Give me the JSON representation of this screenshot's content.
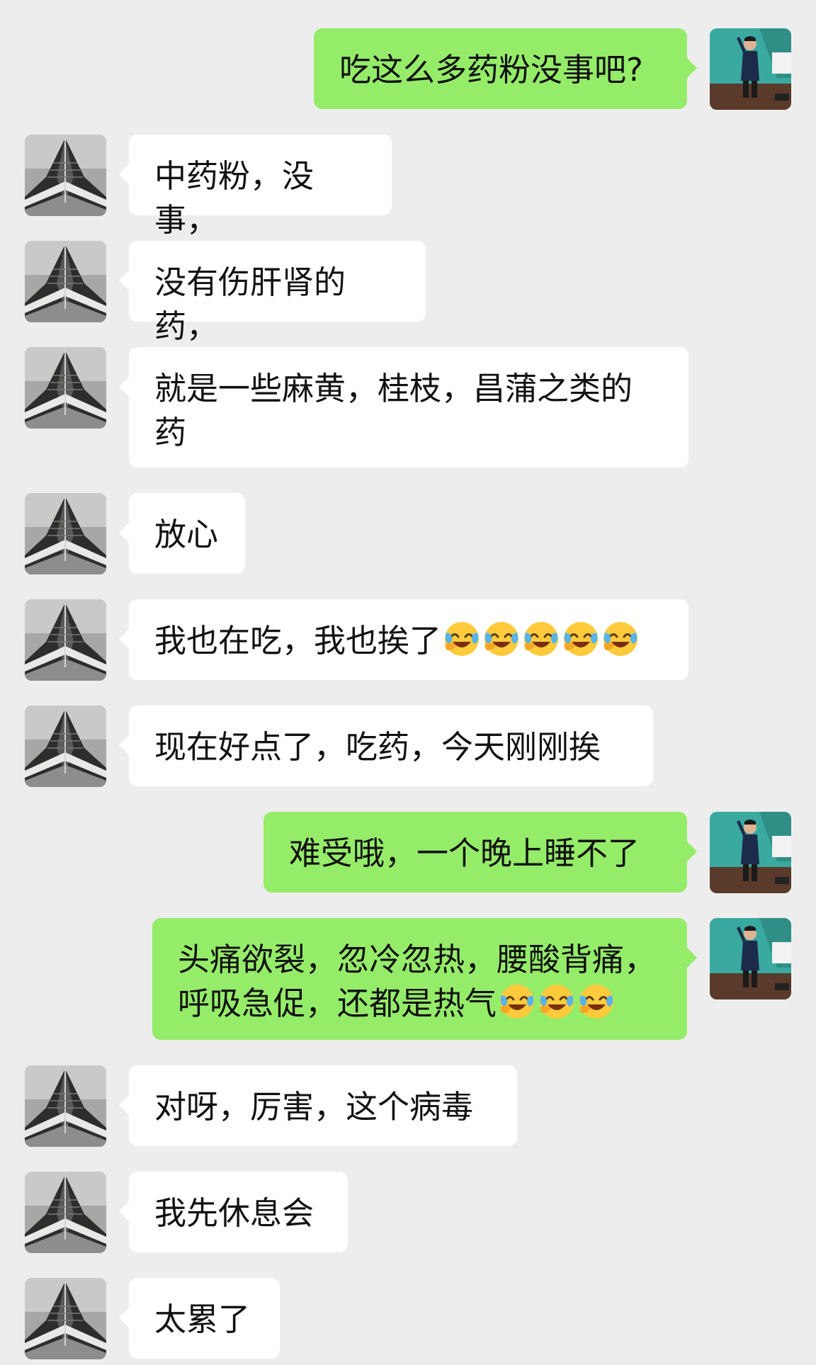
{
  "colors": {
    "background": "#ededed",
    "incoming_bubble": "#ffffff",
    "outgoing_bubble": "#95ec69",
    "text": "#111111"
  },
  "avatars": {
    "incoming": "building-tower-avatar",
    "outgoing": "speaker-on-stage-avatar"
  },
  "messages": [
    {
      "sender": "me",
      "text": "吃这么多药粉没事吧?",
      "emoji_count": 0
    },
    {
      "sender": "other",
      "text": "中药粉，没事，",
      "emoji_count": 0
    },
    {
      "sender": "other",
      "text": "没有伤肝肾的药，",
      "emoji_count": 0
    },
    {
      "sender": "other",
      "text": "就是一些麻黄，桂枝，昌蒲之类的药",
      "emoji_count": 0
    },
    {
      "sender": "other",
      "text": "放心",
      "emoji_count": 0
    },
    {
      "sender": "other",
      "text": "我也在吃，我也挨了",
      "emoji": "crying-laughing-emoji",
      "emoji_count": 5
    },
    {
      "sender": "other",
      "text": "现在好点了，吃药，今天刚刚挨",
      "emoji_count": 0
    },
    {
      "sender": "me",
      "text": "难受哦，一个晚上睡不了",
      "emoji_count": 0
    },
    {
      "sender": "me",
      "text": "头痛欲裂，忽冷忽热，腰酸背痛，呼吸急促，还都是热气",
      "emoji": "crying-laughing-emoji",
      "emoji_count": 3
    },
    {
      "sender": "other",
      "text": "对呀，厉害，这个病毒",
      "emoji_count": 0
    },
    {
      "sender": "other",
      "text": "我先休息会",
      "emoji_count": 0
    },
    {
      "sender": "other",
      "text": "太累了",
      "emoji_count": 0
    }
  ]
}
